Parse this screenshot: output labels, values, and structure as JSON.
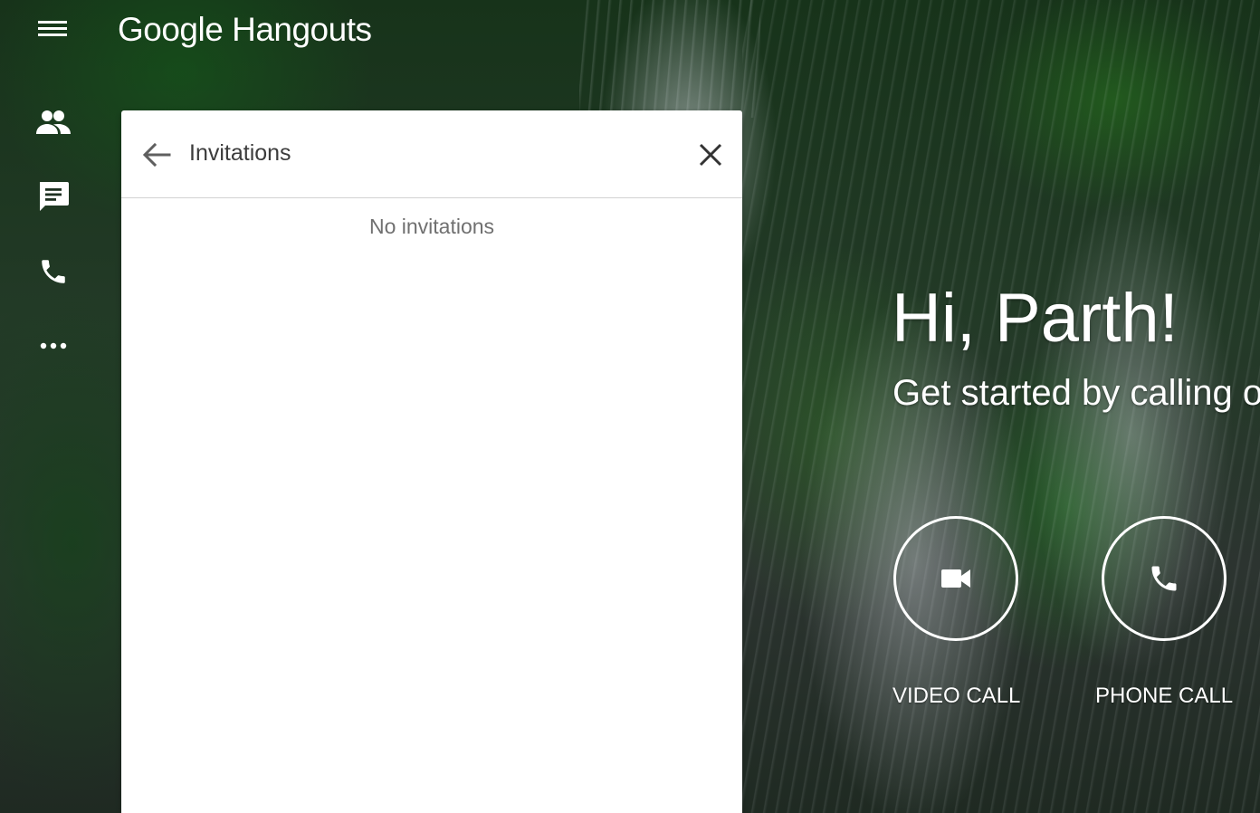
{
  "app": {
    "brand_google": "Google",
    "brand_product": "Hangouts"
  },
  "nav": {
    "items": [
      {
        "icon": "people-icon"
      },
      {
        "icon": "chat-icon"
      },
      {
        "icon": "phone-icon"
      },
      {
        "icon": "more-icon"
      }
    ]
  },
  "panel": {
    "title": "Invitations",
    "empty_message": "No invitations"
  },
  "welcome": {
    "greeting": "Hi, Parth!",
    "subtext": "Get started by calling o",
    "video_label": "VIDEO CALL",
    "phone_label": "PHONE CALL"
  },
  "colors": {
    "panel_bg": "#ffffff",
    "icon_color": "#ffffff",
    "title_text": "#3c3c3c",
    "empty_text": "#707070"
  }
}
